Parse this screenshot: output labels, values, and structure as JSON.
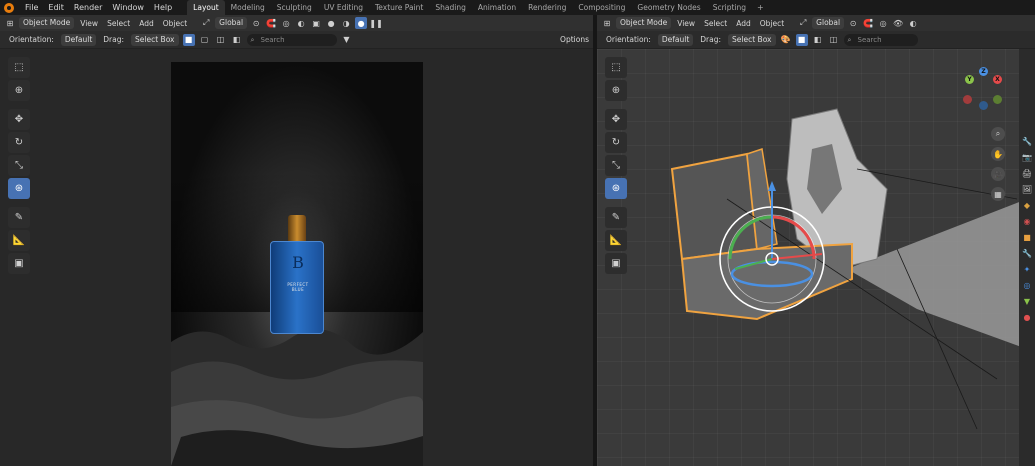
{
  "menu": {
    "items": [
      "File",
      "Edit",
      "Render",
      "Window",
      "Help"
    ]
  },
  "workspaces": {
    "tabs": [
      "Layout",
      "Modeling",
      "Sculpting",
      "UV Editing",
      "Texture Paint",
      "Shading",
      "Animation",
      "Rendering",
      "Compositing",
      "Geometry Nodes",
      "Scripting"
    ],
    "active": "Layout",
    "add": "+"
  },
  "left_view": {
    "mode": "Object Mode",
    "menus": [
      "View",
      "Select",
      "Add",
      "Object"
    ],
    "transform": "Global",
    "orientation_label": "Orientation:",
    "orientation_value": "Default",
    "drag_label": "Drag:",
    "drag_value": "Select Box",
    "search_placeholder": "Search",
    "options": "Options"
  },
  "right_view": {
    "mode": "Object Mode",
    "menus": [
      "View",
      "Select",
      "Add",
      "Object"
    ],
    "transform": "Global",
    "orientation_label": "Orientation:",
    "orientation_value": "Default",
    "drag_label": "Drag:",
    "drag_value": "Select Box",
    "search_placeholder": "Search"
  },
  "render": {
    "product_label": "PERFECT BLUE"
  },
  "gizmo": {
    "x": "X",
    "y": "Y",
    "z": "Z"
  },
  "colors": {
    "accent": "#4772b3",
    "blender_orange": "#e87d0d",
    "axis_x": "#e54a4a",
    "axis_y": "#8bc34a",
    "axis_z": "#4a90e2"
  }
}
